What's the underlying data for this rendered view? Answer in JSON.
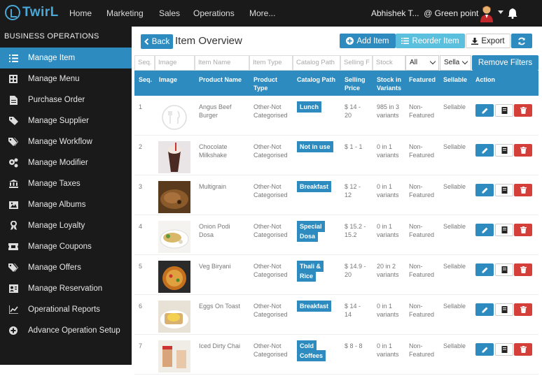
{
  "app": {
    "logo_text": "TwirL"
  },
  "topnav": {
    "items": [
      "Home",
      "Marketing",
      "Sales",
      "Operations",
      "More..."
    ],
    "user": "Abhishek T...",
    "location": "@ Green point"
  },
  "sidebar": {
    "heading": "BUSINESS OPERATIONS",
    "items": [
      {
        "label": "Manage Item",
        "icon": "list-icon",
        "active": true
      },
      {
        "label": "Manage Menu",
        "icon": "grid-icon"
      },
      {
        "label": "Purchase Order",
        "icon": "document-icon"
      },
      {
        "label": "Manage Supplier",
        "icon": "tag-icon"
      },
      {
        "label": "Manage Workflow",
        "icon": "tags-icon"
      },
      {
        "label": "Manage Modifier",
        "icon": "cogs-icon"
      },
      {
        "label": "Manage Taxes",
        "icon": "bank-icon"
      },
      {
        "label": "Manage Albums",
        "icon": "image-icon"
      },
      {
        "label": "Manage Loyalty",
        "icon": "ribbon-icon"
      },
      {
        "label": "Manage Coupons",
        "icon": "ticket-icon"
      },
      {
        "label": "Manage Offers",
        "icon": "tags-icon"
      },
      {
        "label": "Manage Reservation",
        "icon": "contact-card-icon"
      },
      {
        "label": "Operational Reports",
        "icon": "line-chart-icon"
      },
      {
        "label": "Advance Operation Setup",
        "icon": "plus-circle-icon"
      }
    ]
  },
  "page": {
    "back_label": "Back",
    "title": "Item Overview",
    "add_item_label": "Add Item",
    "reorder_item_label": "Reorder Item",
    "export_label": "Export",
    "remove_filters_label": "Remove Filters"
  },
  "filters": {
    "seq": "Seq.",
    "image": "Image",
    "name": "Item Name",
    "type": "Item Type",
    "catalog": "Catalog Path",
    "price": "Selling F",
    "stock": "Stock",
    "featured_value": "All",
    "sellable_value": "Sella"
  },
  "table": {
    "headers": {
      "seq": "Seq.",
      "image": "Image",
      "product_name": "Product Name",
      "product_type_1": "Product",
      "product_type_2": "Type",
      "catalog_path": "Catalog Path",
      "selling_price_1": "Selling",
      "selling_price_2": "Price",
      "stock_1": "Stock in",
      "stock_2": "Variants",
      "featured": "Featured",
      "sellable": "Sellable",
      "action": "Action"
    },
    "rows": [
      {
        "seq": "1",
        "name": [
          "Angus Beef",
          "Burger"
        ],
        "type": [
          "Other-Not",
          "Categorised"
        ],
        "catalog": [
          "Lunch"
        ],
        "price": [
          "$ 14 -",
          "20"
        ],
        "stock": [
          "985 in 3",
          "variants"
        ],
        "featured": [
          "Non-",
          "Featured"
        ],
        "sellable": "Sellable"
      },
      {
        "seq": "2",
        "name": [
          "Chocolate",
          "Milkshake"
        ],
        "type": [
          "Other-Not",
          "Categorised"
        ],
        "catalog": [
          "Not in use"
        ],
        "price": [
          "$ 1 - 1",
          ""
        ],
        "stock": [
          "0 in 1",
          "variants"
        ],
        "featured": [
          "Non-",
          "Featured"
        ],
        "sellable": "Sellable"
      },
      {
        "seq": "3",
        "name": [
          "Multigrain",
          ""
        ],
        "type": [
          "Other-Not",
          "Categorised"
        ],
        "catalog": [
          "Breakfast"
        ],
        "price": [
          "$ 12 -",
          "12"
        ],
        "stock": [
          "0 in 1",
          "variants"
        ],
        "featured": [
          "Non-",
          "Featured"
        ],
        "sellable": "Sellable"
      },
      {
        "seq": "4",
        "name": [
          "Onion Podi",
          "Dosa"
        ],
        "type": [
          "Other-Not",
          "Categorised"
        ],
        "catalog": [
          "Special",
          "Dosa"
        ],
        "price": [
          "$ 15.2 -",
          "15.2"
        ],
        "stock": [
          "0 in 1",
          "variants"
        ],
        "featured": [
          "Non-",
          "Featured"
        ],
        "sellable": "Sellable"
      },
      {
        "seq": "5",
        "name": [
          "Veg Biryani",
          ""
        ],
        "type": [
          "Other-Not",
          "Categorised"
        ],
        "catalog": [
          "Thali &",
          "Rice"
        ],
        "price": [
          "$ 14.9 -",
          "20"
        ],
        "stock": [
          "20 in 2",
          "variants"
        ],
        "featured": [
          "Non-",
          "Featured"
        ],
        "sellable": "Sellable"
      },
      {
        "seq": "6",
        "name": [
          "Eggs On Toast",
          ""
        ],
        "type": [
          "Other-Not",
          "Categorised"
        ],
        "catalog": [
          "Breakfast"
        ],
        "price": [
          "$ 14 -",
          "14"
        ],
        "stock": [
          "0 in 1",
          "variants"
        ],
        "featured": [
          "Non-",
          "Featured"
        ],
        "sellable": "Sellable"
      },
      {
        "seq": "7",
        "name": [
          "Iced Dirty Chai",
          ""
        ],
        "type": [
          "Other-Not",
          "Categorised"
        ],
        "catalog": [
          "Cold",
          "Coffees"
        ],
        "price": [
          "$ 8 - 8",
          ""
        ],
        "stock": [
          "0 in 1",
          "variants"
        ],
        "featured": [
          "Non-",
          "Featured"
        ],
        "sellable": "Sellable"
      }
    ]
  },
  "colors": {
    "accent": "#2e8bc0",
    "delete": "#d43f3a",
    "sidebar": "#1a1a1a",
    "teal": "#5bc0de"
  }
}
